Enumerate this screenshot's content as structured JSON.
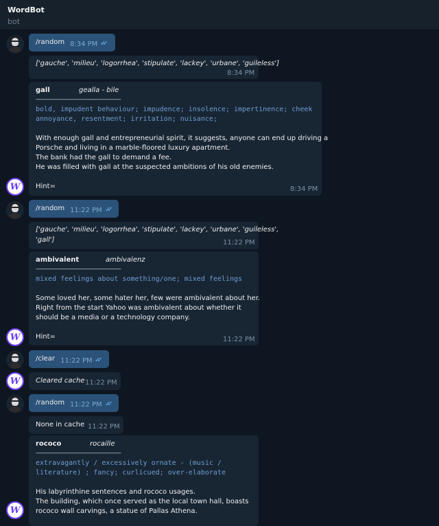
{
  "header": {
    "title": "WordBot",
    "subtitle": "bot"
  },
  "messages": {
    "m1": {
      "text": "/random",
      "time": "8:34 PM"
    },
    "m2": {
      "text": "['gauche', 'milieu', 'logorrhea', 'stipulate', 'lackey', 'urbane', 'guileless']",
      "time": "8:34 PM"
    },
    "m3": {
      "word": "gall",
      "translation": "gealla - bile",
      "separator": "----------------------------------------------------",
      "def1": "bold, impudent behaviour; impudence; insolence; impertinence; cheek",
      "def2": "annoyance, resentment; irritation; nuisance;",
      "ex1": "With enough gall and entrepreneurial spirit, it suggests, anyone can end up driving a",
      "ex2": "Porsche and living in a marble-floored luxury apartment.",
      "ex3": "The bank had the gall to demand a fee.",
      "ex4": "He was filled with gall at the suspected ambitions of his old enemies.",
      "hint": "Hint=",
      "time": "8:34 PM"
    },
    "m4": {
      "text": "/random",
      "time": "11:22 PM"
    },
    "m5": {
      "line1": "['gauche', 'milieu', 'logorrhea', 'stipulate', 'lackey', 'urbane', 'guileless',",
      "line2": "'gall']",
      "time": "11:22 PM"
    },
    "m6": {
      "word": "ambivalent",
      "translation": "ambivalenz",
      "separator": "----------------------------------------------------",
      "def1": "mixed feelings about something/one; mixed feelings",
      "ex1": "Some loved her, some hater her, few were ambivalent about her.",
      "ex2": "Right from the start Yahoo was ambivalent about whether it",
      "ex3": "should be a media or a technology company.",
      "hint": "Hint=",
      "time": "11:22 PM"
    },
    "m7": {
      "text": "/clear",
      "time": "11:22 PM"
    },
    "m8": {
      "text": "Cleared cache",
      "time": "11:22 PM"
    },
    "m9": {
      "text": "/random",
      "time": "11:22 PM"
    },
    "m10": {
      "text": "None in cache",
      "time": "11:22 PM"
    },
    "m11": {
      "word": "rococo",
      "translation": "rocaille",
      "separator": "----------------------------------------------------",
      "def1": "extravagantly / excessively ornate - (music /",
      "def2": "literature) ; fancy; curlicued; over-elaborate",
      "ex1": "His labyrinthine sentences and rococo usages.",
      "ex2": "The building, which once served as the local town hall, boasts",
      "ex3": "rococo wall carvings, a statue of Pallas Athena."
    }
  },
  "icons": {
    "read_receipt": "double-check-icon",
    "bot_avatar": "wordbot-logo",
    "user_avatar": "user-photo"
  },
  "colors": {
    "outgoing": "#2b5278",
    "incoming": "#182533",
    "background": "#0e1621",
    "accent": "#6ab3f3"
  }
}
